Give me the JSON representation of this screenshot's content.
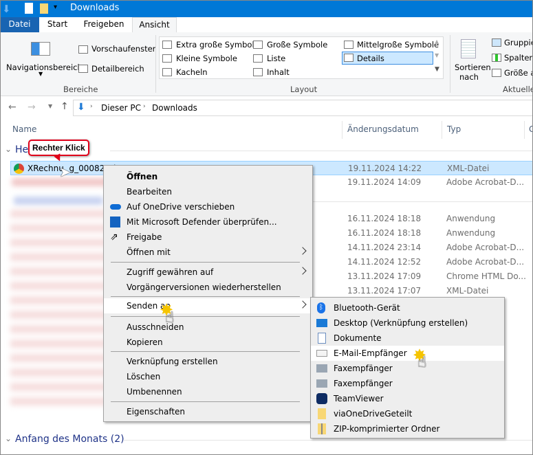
{
  "window": {
    "title": "Downloads"
  },
  "tabs": [
    "Datei",
    "Start",
    "Freigeben",
    "Ansicht"
  ],
  "ribbon": {
    "panes": {
      "nav": "Navigationsbereich",
      "preview": "Vorschaufenster",
      "details": "Detailbereich",
      "group": "Bereiche"
    },
    "layout": {
      "items": [
        "Extra große Symbole",
        "Große Symbole",
        "Mittelgroße Symbole",
        "Kleine Symbole",
        "Liste",
        "Details",
        "Kacheln",
        "Inhalt"
      ],
      "selected": "Details",
      "group": "Layout"
    },
    "current": {
      "sort": "Sortieren",
      "sort2": "nach",
      "groupby": "Gruppie",
      "columns": "Spalten",
      "size": "Größe a",
      "group": "Aktuelle"
    }
  },
  "address": {
    "crumbs": [
      "Dieser PC",
      "Downloads"
    ]
  },
  "columns": [
    "Name",
    "Änderungsdatum",
    "Typ",
    "G"
  ],
  "groups": {
    "today": "He",
    "month": "Anfang des Monats (2)"
  },
  "callout": "Rechter Klick",
  "selected_file": "XRechnu  g_000824 (",
  "rows": [
    {
      "date": "19.11.2024 14:22",
      "type": "XML-Datei"
    },
    {
      "date": "19.11.2024 14:09",
      "type": "Adobe Acrobat-D..."
    },
    {
      "date": "16.11.2024 18:18",
      "type": "Anwendung"
    },
    {
      "date": "16.11.2024 18:18",
      "type": "Anwendung"
    },
    {
      "date": "14.11.2024 23:14",
      "type": "Adobe Acrobat-D..."
    },
    {
      "date": "14.11.2024 12:52",
      "type": "Adobe Acrobat-D..."
    },
    {
      "date": "13.11.2024 17:09",
      "type": "Chrome HTML Do..."
    },
    {
      "date": "13.11.2024 17:07",
      "type": "XML-Datei"
    }
  ],
  "context_menu": [
    "Öffnen",
    "Bearbeiten",
    "Auf OneDrive verschieben",
    "Mit Microsoft Defender überprüfen...",
    "Freigabe",
    "Öffnen mit",
    "Zugriff gewähren auf",
    "Vorgängerversionen wiederherstellen",
    "Senden an",
    "Ausschneiden",
    "Kopieren",
    "Verknüpfung erstellen",
    "Löschen",
    "Umbenennen",
    "Eigenschaften"
  ],
  "send_to": [
    "Bluetooth-Gerät",
    "Desktop (Verknüpfung erstellen)",
    "Dokumente",
    "E-Mail-Empfänger",
    "Faxempfänger",
    "Faxempfänger",
    "TeamViewer",
    "viaOneDriveGeteilt",
    "ZIP-komprimierter Ordner"
  ],
  "colors": {
    "titlebar": "#0078d7",
    "selection": "#cce8ff",
    "callout": "#e0001a",
    "group": "#1e3287"
  }
}
